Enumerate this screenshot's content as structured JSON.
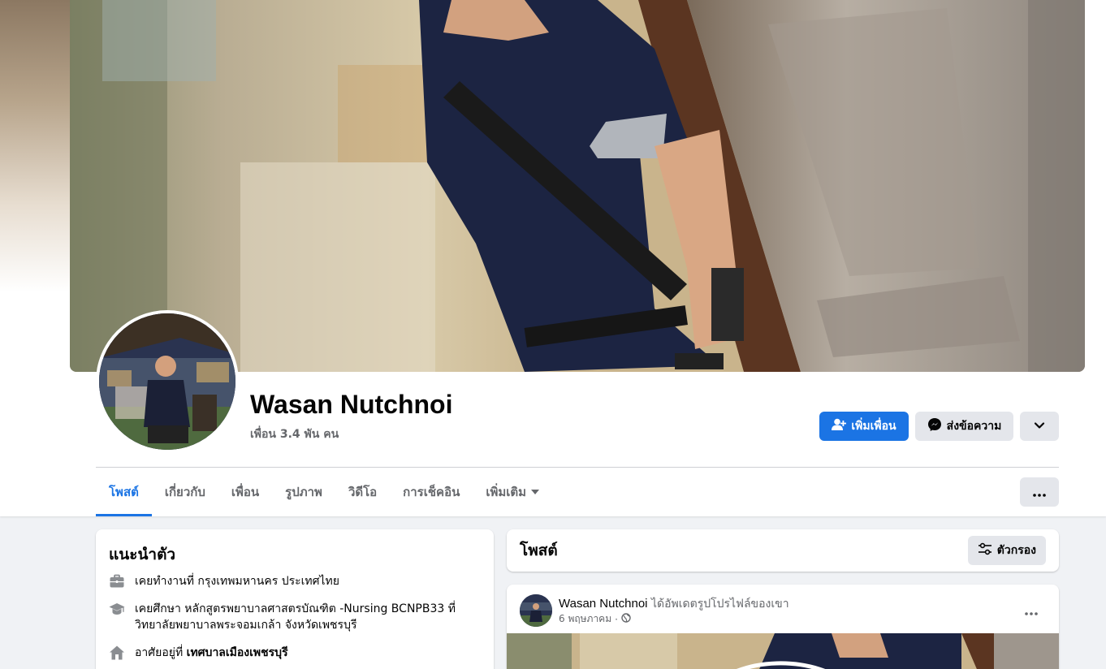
{
  "profile": {
    "name": "Wasan Nutchnoi",
    "friends_count": "เพื่อน 3.4 พัน คน"
  },
  "actions": {
    "add_friend": "เพิ่มเพื่อน",
    "message": "ส่งข้อความ"
  },
  "tabs": [
    {
      "label": "โพสต์",
      "active": true
    },
    {
      "label": "เกี่ยวกับ",
      "active": false
    },
    {
      "label": "เพื่อน",
      "active": false
    },
    {
      "label": "รูปภาพ",
      "active": false
    },
    {
      "label": "วิดีโอ",
      "active": false
    },
    {
      "label": "การเช็คอิน",
      "active": false
    },
    {
      "label": "เพิ่มเติม",
      "active": false
    }
  ],
  "intro": {
    "title": "แนะนำตัว",
    "work_prefix": "เคยทำงานที่ ",
    "work_place": "กรุงเทพมหานคร ประเทศไทย",
    "study_text": "เคยศึกษา หลักสูตรพยาบาลศาสตรบัณฑิต -Nursing BCNPB33 ที่ วิทยาลัยพยาบาลพระจอมเกล้า จังหวัดเพชรบุรี",
    "lives_prefix": "อาศัยอยู่ที่ ",
    "lives_place": "เทศบาลเมืองเพชรบุรี"
  },
  "posts": {
    "title": "โพสต์",
    "filter_label": "ตัวกรอง"
  },
  "post": {
    "author": "Wasan Nutchnoi",
    "action": " ได้อัพเดตรูปโปรไฟล์ของเขา",
    "date": "6 พฤษภาคม",
    "audience_icon": "globe-icon"
  },
  "colors": {
    "primary": "#1b74e4",
    "secondary_button": "#e4e6eb",
    "page_background": "#f0f2f5",
    "muted_text": "#65676b"
  }
}
